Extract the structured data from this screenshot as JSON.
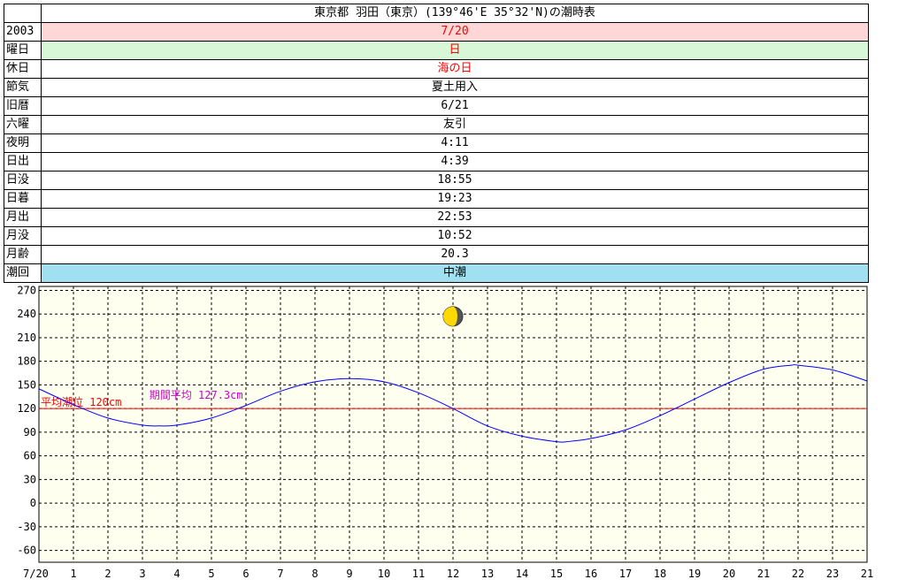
{
  "table": {
    "title": "東京都 羽田（東京）(139°46'E 35°32'N)の潮時表",
    "rows": [
      {
        "label": "2003",
        "value": "7/20",
        "style": "date"
      },
      {
        "label": "曜日",
        "value": "日",
        "style": "weekday"
      },
      {
        "label": "休日",
        "value": "海の日",
        "style": "holiday"
      },
      {
        "label": "節気",
        "value": "夏土用入",
        "style": "plain"
      },
      {
        "label": "旧暦",
        "value": "6/21",
        "style": "plain"
      },
      {
        "label": "六曜",
        "value": "友引",
        "style": "plain"
      },
      {
        "label": "夜明",
        "value": "4:11",
        "style": "plain"
      },
      {
        "label": "日出",
        "value": "4:39",
        "style": "plain"
      },
      {
        "label": "日没",
        "value": "18:55",
        "style": "plain"
      },
      {
        "label": "日暮",
        "value": "19:23",
        "style": "plain"
      },
      {
        "label": "月出",
        "value": "22:53",
        "style": "plain"
      },
      {
        "label": "月没",
        "value": "10:52",
        "style": "plain"
      },
      {
        "label": "月齢",
        "value": "20.3",
        "style": "plain"
      },
      {
        "label": "潮回",
        "value": "中潮",
        "style": "tide"
      }
    ]
  },
  "colors": {
    "plot_bg": "#fffff0",
    "grid": "#000000",
    "tide_line": "#0000ff",
    "mean_line": "#ff0000",
    "mean_label": "#ff0000",
    "period_label": "#cc00cc",
    "moon_light": "#ffd800",
    "moon_dark": "#555555"
  },
  "chart_data": {
    "type": "line",
    "x_tick_labels": [
      "7/20",
      "1",
      "2",
      "3",
      "4",
      "5",
      "6",
      "7",
      "8",
      "9",
      "10",
      "11",
      "12",
      "13",
      "14",
      "15",
      "16",
      "17",
      "18",
      "19",
      "20",
      "21",
      "22",
      "23",
      "21"
    ],
    "xlim": [
      0,
      24
    ],
    "ylim": [
      -75,
      275
    ],
    "y_ticks": [
      270,
      240,
      210,
      180,
      150,
      120,
      90,
      60,
      30,
      0,
      -30,
      -60
    ],
    "grid": true,
    "series": [
      {
        "x": [
          0,
          1,
          2,
          3,
          3.5,
          4,
          5,
          6,
          7,
          8,
          9,
          10,
          11,
          12,
          13,
          14,
          15,
          15.3,
          16,
          17,
          18,
          19,
          20,
          21,
          21.8,
          22,
          23,
          24
        ],
        "y": [
          145,
          125,
          108,
          99,
          98,
          99,
          108,
          124,
          142,
          154,
          158,
          154,
          140,
          120,
          98,
          85,
          78,
          78,
          82,
          93,
          111,
          132,
          153,
          170,
          175,
          175,
          169,
          155
        ]
      }
    ],
    "mean_level": 120,
    "annotations": {
      "mean_label": "平均潮位 120cm",
      "period_label": "期間平均 127.3cm"
    },
    "moon": {
      "x": 12,
      "y": 237
    }
  }
}
